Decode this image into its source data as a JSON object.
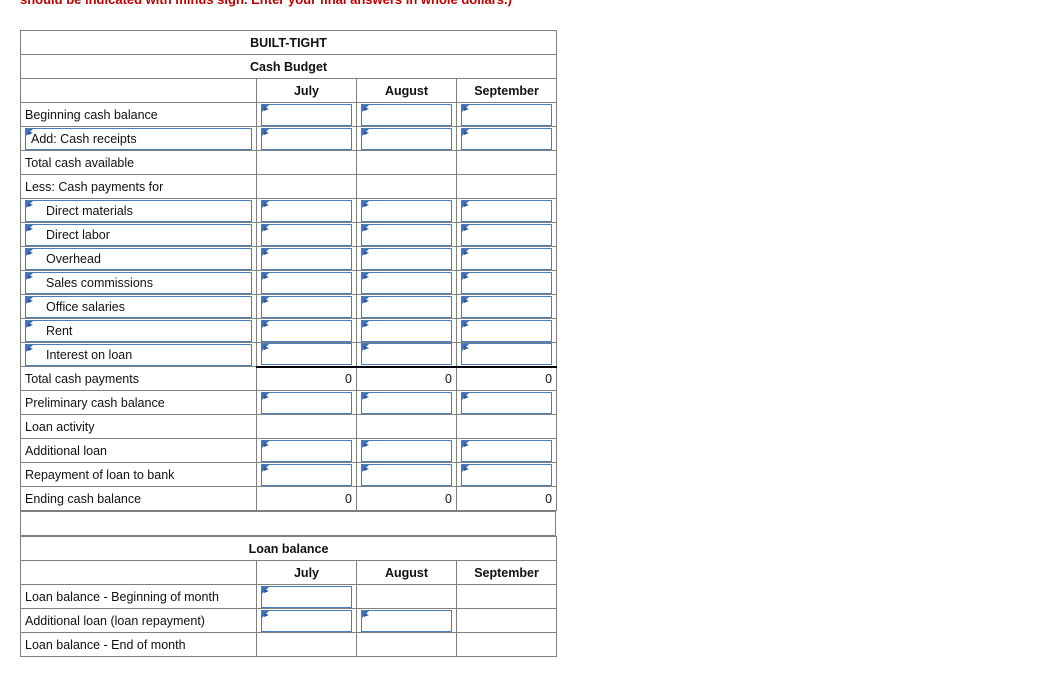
{
  "instruction": "should be indicated with minus sign. Enter your final answers in whole dollars.)",
  "colors": {
    "header_blue": "#7bace4",
    "highlight_yellow": "#ffffb3",
    "field_border_blue": "#4a7ebb",
    "instruction_red": "#c00000"
  },
  "cash_budget": {
    "company_title": "BUILT-TIGHT",
    "statement_title": "Cash Budget",
    "corner_label": "",
    "months": [
      "July",
      "August",
      "September"
    ],
    "rows": [
      {
        "label": "Beginning cash balance",
        "label_field": false,
        "indent": false,
        "cells": [
          {
            "kind": "field",
            "value": ""
          },
          {
            "kind": "field",
            "value": ""
          },
          {
            "kind": "field",
            "value": ""
          }
        ]
      },
      {
        "label": "Add: Cash receipts",
        "label_field": true,
        "indent": false,
        "cells": [
          {
            "kind": "field",
            "value": ""
          },
          {
            "kind": "field",
            "value": ""
          },
          {
            "kind": "field",
            "value": ""
          }
        ]
      },
      {
        "label": "Total cash available",
        "label_field": false,
        "indent": false,
        "cells": [
          {
            "kind": "plain",
            "value": ""
          },
          {
            "kind": "plain",
            "value": ""
          },
          {
            "kind": "plain",
            "value": ""
          }
        ]
      },
      {
        "label": "Less: Cash payments for",
        "label_field": false,
        "indent": false,
        "cells": [
          {
            "kind": "plain",
            "value": ""
          },
          {
            "kind": "plain",
            "value": ""
          },
          {
            "kind": "plain",
            "value": ""
          }
        ]
      },
      {
        "label": "Direct materials",
        "label_field": true,
        "indent": true,
        "cells": [
          {
            "kind": "field",
            "value": ""
          },
          {
            "kind": "field",
            "value": ""
          },
          {
            "kind": "field",
            "value": ""
          }
        ]
      },
      {
        "label": "Direct labor",
        "label_field": true,
        "indent": true,
        "cells": [
          {
            "kind": "field",
            "value": ""
          },
          {
            "kind": "field",
            "value": ""
          },
          {
            "kind": "field",
            "value": ""
          }
        ]
      },
      {
        "label": "Overhead",
        "label_field": true,
        "indent": true,
        "cells": [
          {
            "kind": "field",
            "value": ""
          },
          {
            "kind": "field",
            "value": ""
          },
          {
            "kind": "field",
            "value": ""
          }
        ]
      },
      {
        "label": "Sales commissions",
        "label_field": true,
        "indent": true,
        "cells": [
          {
            "kind": "field",
            "value": ""
          },
          {
            "kind": "field",
            "value": ""
          },
          {
            "kind": "field",
            "value": ""
          }
        ]
      },
      {
        "label": "Office salaries",
        "label_field": true,
        "indent": true,
        "cells": [
          {
            "kind": "field",
            "value": ""
          },
          {
            "kind": "field",
            "value": ""
          },
          {
            "kind": "field",
            "value": ""
          }
        ]
      },
      {
        "label": "Rent",
        "label_field": true,
        "indent": true,
        "cells": [
          {
            "kind": "field",
            "value": ""
          },
          {
            "kind": "field",
            "value": ""
          },
          {
            "kind": "field",
            "value": ""
          }
        ]
      },
      {
        "label": "Interest on loan",
        "label_field": true,
        "indent": true,
        "cells": [
          {
            "kind": "field",
            "value": ""
          },
          {
            "kind": "field",
            "value": ""
          },
          {
            "kind": "field",
            "value": ""
          }
        ]
      },
      {
        "label": "Total cash payments",
        "label_field": false,
        "indent": false,
        "cells": [
          {
            "kind": "total",
            "value": "0"
          },
          {
            "kind": "total",
            "value": "0"
          },
          {
            "kind": "total",
            "value": "0"
          }
        ]
      },
      {
        "label": "Preliminary cash balance",
        "label_field": false,
        "indent": false,
        "cells": [
          {
            "kind": "field",
            "value": ""
          },
          {
            "kind": "field",
            "value": ""
          },
          {
            "kind": "field",
            "value": ""
          }
        ]
      },
      {
        "label": "Loan activity",
        "label_field": false,
        "indent": false,
        "cells": [
          {
            "kind": "plain",
            "value": ""
          },
          {
            "kind": "plain",
            "value": ""
          },
          {
            "kind": "plain",
            "value": ""
          }
        ]
      },
      {
        "label": "Additional loan",
        "label_field": false,
        "indent": false,
        "cells": [
          {
            "kind": "field",
            "value": ""
          },
          {
            "kind": "field",
            "value": ""
          },
          {
            "kind": "field",
            "value": ""
          }
        ]
      },
      {
        "label": "Repayment of loan to bank",
        "label_field": false,
        "indent": false,
        "cells": [
          {
            "kind": "field",
            "value": ""
          },
          {
            "kind": "field",
            "value": ""
          },
          {
            "kind": "field",
            "value": ""
          }
        ]
      },
      {
        "label": "Ending cash balance",
        "label_field": false,
        "indent": false,
        "cells": [
          {
            "kind": "yellow",
            "value": "0"
          },
          {
            "kind": "yellow",
            "value": "0"
          },
          {
            "kind": "yellow",
            "value": "0"
          }
        ]
      }
    ]
  },
  "loan_balance": {
    "title": "Loan balance",
    "corner_label": "",
    "months": [
      "July",
      "August",
      "September"
    ],
    "rows": [
      {
        "label": "Loan balance - Beginning of month",
        "label_field": false,
        "indent": false,
        "cells": [
          {
            "kind": "field",
            "value": ""
          },
          {
            "kind": "plain",
            "value": ""
          },
          {
            "kind": "plain",
            "value": ""
          }
        ]
      },
      {
        "label": "Additional loan (loan repayment)",
        "label_field": false,
        "indent": false,
        "cells": [
          {
            "kind": "field",
            "value": ""
          },
          {
            "kind": "field",
            "value": ""
          },
          {
            "kind": "plain",
            "value": ""
          }
        ]
      },
      {
        "label": "Loan balance - End of month",
        "label_field": false,
        "indent": false,
        "cells": [
          {
            "kind": "yellow",
            "value": ""
          },
          {
            "kind": "yellow",
            "value": ""
          },
          {
            "kind": "yellow",
            "value": ""
          }
        ]
      }
    ]
  }
}
